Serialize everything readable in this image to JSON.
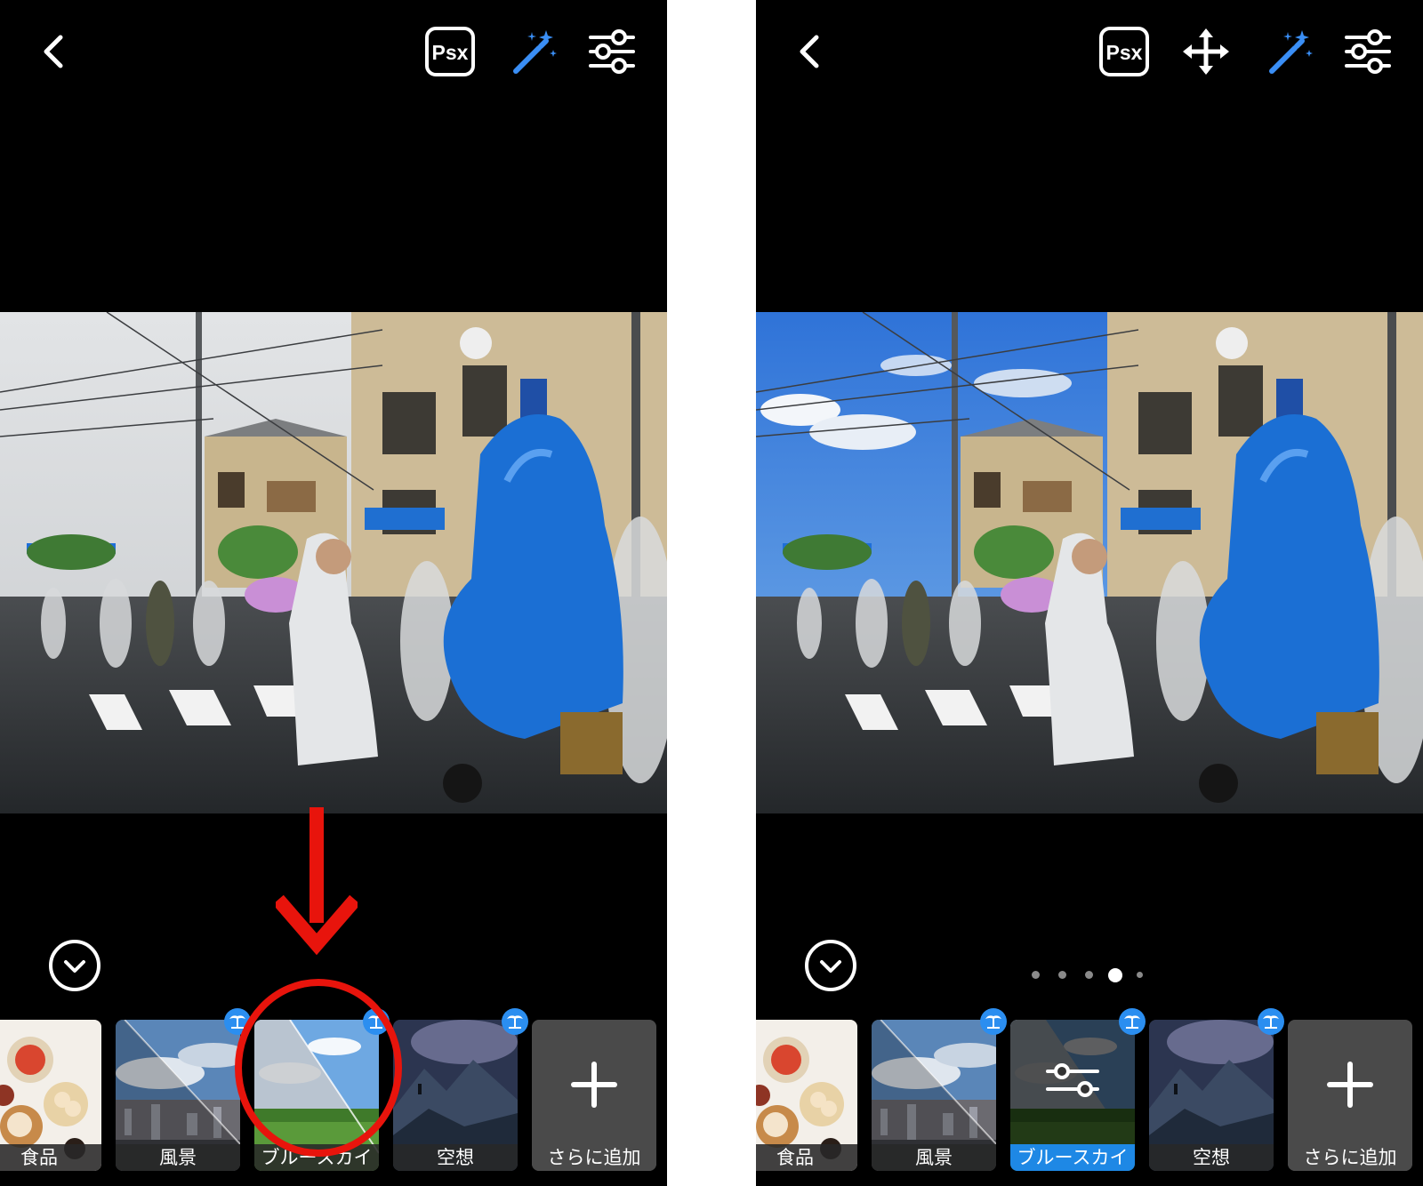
{
  "left_screen": {
    "toolbar": {
      "back_icon": "chevron-left-icon",
      "psx_label": "Psx",
      "auto_fix_icon": "magic-wand-icon",
      "adjust_icon": "sliders-icon"
    },
    "looks_panel": {
      "collapse_icon": "chevron-down-icon",
      "thumbnails": [
        {
          "label": "食品",
          "premium": false
        },
        {
          "label": "風景",
          "premium": true
        },
        {
          "label": "ブルースカイ",
          "premium": true
        },
        {
          "label": "空想",
          "premium": true
        },
        {
          "label": "さらに追加",
          "premium": false
        }
      ]
    },
    "annotation": {
      "arrow_color": "#e8140c",
      "circle_color": "#e8140c"
    }
  },
  "right_screen": {
    "toolbar": {
      "back_icon": "chevron-left-icon",
      "psx_label": "Psx",
      "move_icon": "move-arrows-icon",
      "auto_fix_icon": "magic-wand-icon",
      "adjust_icon": "sliders-icon"
    },
    "looks_panel": {
      "collapse_icon": "chevron-down-icon",
      "page_indicator": {
        "pages": 5,
        "current": 4
      },
      "thumbnails": [
        {
          "label": "食品",
          "premium": false
        },
        {
          "label": "風景",
          "premium": true
        },
        {
          "label": "ブルースカイ",
          "premium": true,
          "selected": true
        },
        {
          "label": "空想",
          "premium": true
        },
        {
          "label": "さらに追加",
          "premium": false
        }
      ]
    }
  },
  "colors": {
    "background": "#000000",
    "accent_blue": "#2b8ef0",
    "selected_label": "#1e88e5",
    "wand_blue": "#3a8ef5",
    "annotation_red": "#e8140c"
  }
}
